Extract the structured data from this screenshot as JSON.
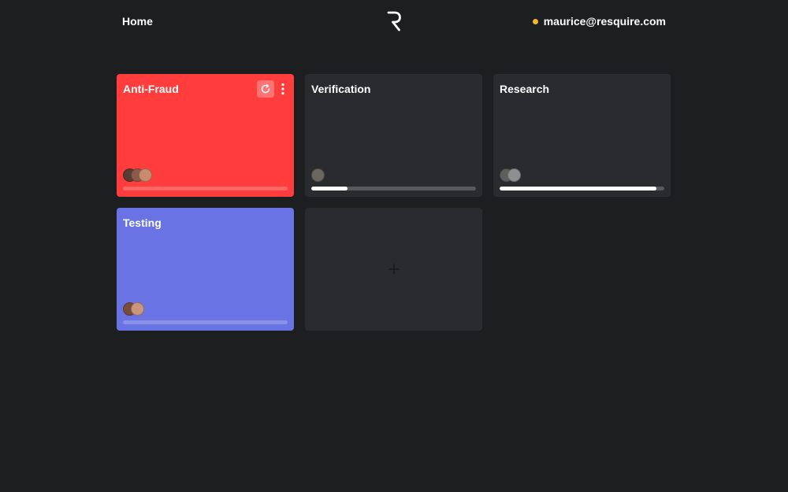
{
  "header": {
    "home_label": "Home",
    "user_email": "maurice@resquire.com",
    "status_color": "#f5b82e"
  },
  "colors": {
    "background": "#1d1e20",
    "card_default": "#2a2b2f",
    "anti_fraud": "#ff3d3d",
    "testing": "#6a73e3"
  },
  "cards": [
    {
      "title": "Anti-Fraud",
      "color": "#ff3d3d",
      "progress": 0,
      "avatars": 3,
      "has_actions": true
    },
    {
      "title": "Verification",
      "color": "#2a2b2f",
      "progress": 0.22,
      "avatars": 1,
      "has_actions": false
    },
    {
      "title": "Research",
      "color": "#2a2b2f",
      "progress": 0.95,
      "avatars": 2,
      "has_actions": false
    },
    {
      "title": "Testing",
      "color": "#6a73e3",
      "progress": 0,
      "avatars": 2,
      "has_actions": false
    }
  ],
  "icons": {
    "refresh": "refresh-icon",
    "menu": "more-vertical-icon",
    "add": "plus-icon",
    "logo": "resquire-logo"
  }
}
